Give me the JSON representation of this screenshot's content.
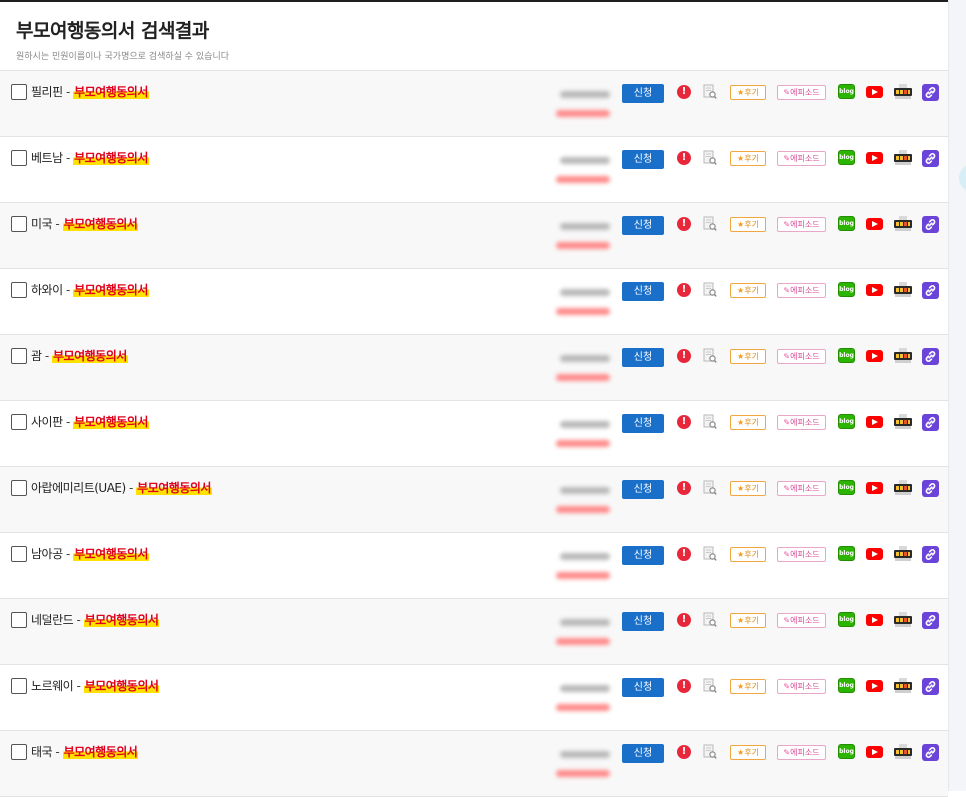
{
  "header": {
    "title": "부모여행동의서 검색결과",
    "subtitle": "원하시는 민원이름이나 국가명으로 검색하실 수 있습니다"
  },
  "labels": {
    "doc_suffix": "부모여행동의서",
    "separator": " - ",
    "apply": "신청",
    "alert": "!",
    "review": "후기",
    "episode": "에피소드",
    "blog": "blog"
  },
  "colors": {
    "apply_button": "#1a6fc9",
    "highlight_text": "#e0001b",
    "highlight_bg": "#ffe100",
    "alert": "#e8283a",
    "blog": "#2db400",
    "youtube": "#ff0000",
    "link": "#6a44d8"
  },
  "icons": {
    "alert": "exclamation-circle-icon",
    "preview": "document-search-icon",
    "blog": "naver-blog-icon",
    "youtube": "youtube-icon",
    "news": "news-icon",
    "link": "link-icon"
  },
  "rows": [
    {
      "country": "필리핀"
    },
    {
      "country": "베트남"
    },
    {
      "country": "미국"
    },
    {
      "country": "하와이"
    },
    {
      "country": "괌"
    },
    {
      "country": "사이판"
    },
    {
      "country": "아랍에미리트(UAE)"
    },
    {
      "country": "남아공"
    },
    {
      "country": "네덜란드"
    },
    {
      "country": "노르웨이"
    },
    {
      "country": "태국"
    }
  ]
}
